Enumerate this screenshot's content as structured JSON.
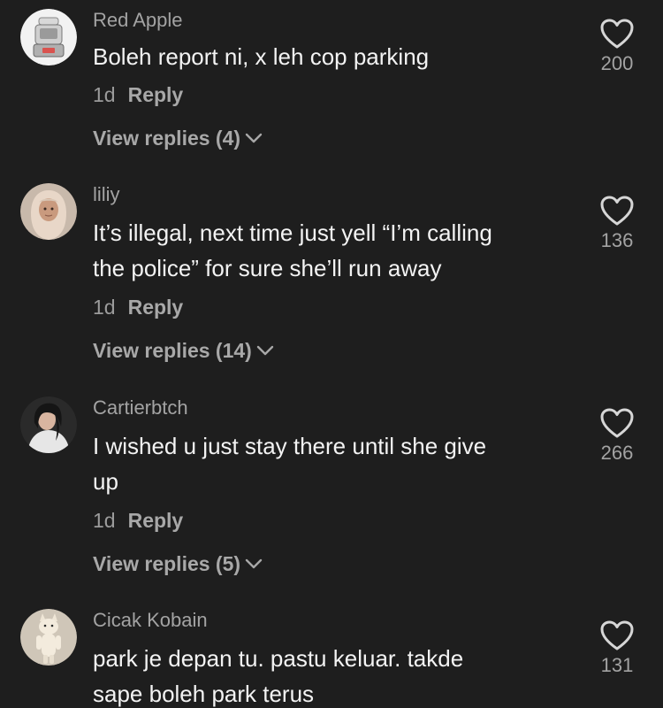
{
  "comments": [
    {
      "username": "Red Apple",
      "lines": [
        "Boleh report ni, x leh cop parking"
      ],
      "time": "1d",
      "reply_label": "Reply",
      "view_replies": "View replies (4)",
      "likes": "200",
      "avatar_icon": "kitchen-appliance-avatar"
    },
    {
      "username": "liliy",
      "lines": [
        "It’s illegal, next time just yell “I’m calling",
        "the police” for sure she’ll run away"
      ],
      "time": "1d",
      "reply_label": "Reply",
      "view_replies": "View replies (14)",
      "likes": "136",
      "avatar_icon": "hijab-person-avatar"
    },
    {
      "username": "Cartierbtch",
      "lines": [
        "I wished u just stay there until she give",
        "up"
      ],
      "time": "1d",
      "reply_label": "Reply",
      "view_replies": "View replies (5)",
      "likes": "266",
      "avatar_icon": "person-avatar"
    },
    {
      "username": "Cicak Kobain",
      "lines": [
        "park je depan tu. pastu keluar. takde",
        "sape boleh park terus"
      ],
      "likes": "131",
      "avatar_icon": "cat-avatar"
    }
  ],
  "colors": {
    "background": "#1e1e1e",
    "username": "#a3a3a3",
    "text": "#f3f3f3",
    "secondary": "#9b9b9b"
  }
}
